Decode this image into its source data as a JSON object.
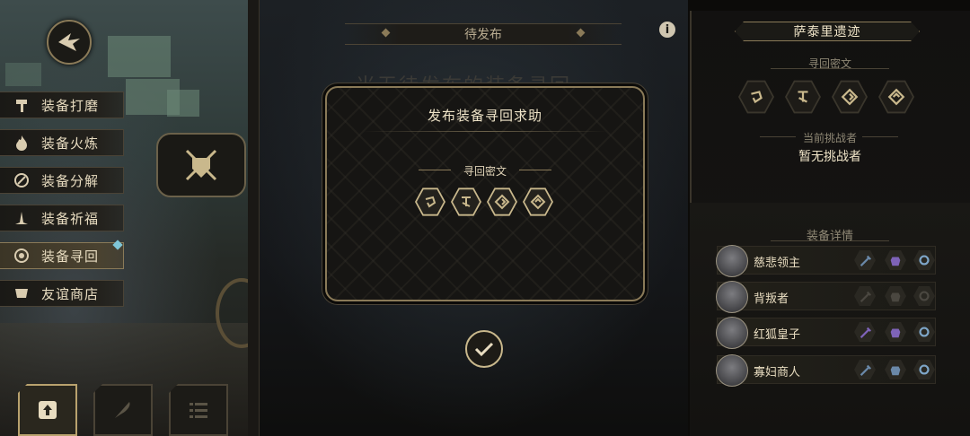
{
  "left_menu": {
    "items": [
      {
        "label": "装备打磨",
        "icon": "hammer-icon"
      },
      {
        "label": "装备火炼",
        "icon": "flame-icon"
      },
      {
        "label": "装备分解",
        "icon": "disassemble-icon"
      },
      {
        "label": "装备祈福",
        "icon": "pray-icon"
      },
      {
        "label": "装备寻回",
        "icon": "target-icon",
        "active": true
      },
      {
        "label": "友谊商店",
        "icon": "shop-icon"
      }
    ]
  },
  "middle": {
    "tab_title": "待发布",
    "empty_text": "当无待发布的装备寻回",
    "dialog": {
      "title": "发布装备寻回求助",
      "sub_label": "寻回密文",
      "runes": [
        "rune-1-icon",
        "rune-2-icon",
        "rune-3-icon",
        "rune-4-icon"
      ]
    }
  },
  "right": {
    "location": "萨泰里遗迹",
    "cipher_label": "寻回密文",
    "challenger_label": "当前挑战者",
    "challenger_value": "暂无挑战者",
    "equip_label": "装备详情",
    "equip_rows": [
      {
        "name": "慈悲领主",
        "weapon": "#6a88a8",
        "armor": "#7e63b8",
        "ring": "#7ea6c8"
      },
      {
        "name": "背叛者",
        "weapon": "#4a4740",
        "armor": "#4a4740",
        "ring": "#4a4740"
      },
      {
        "name": "红狐皇子",
        "weapon": "#7e63b8",
        "armor": "#7e63b8",
        "ring": "#7ea6c8"
      },
      {
        "name": "寡妇商人",
        "weapon": "#6a88a8",
        "armor": "#6a88a8",
        "ring": "#7ea6c8"
      }
    ]
  },
  "colors": {
    "accent_gold": "#c9b88c",
    "frame_gold": "#8a7a58",
    "text_light": "#efe4c8",
    "text_dim": "#8f8875"
  }
}
